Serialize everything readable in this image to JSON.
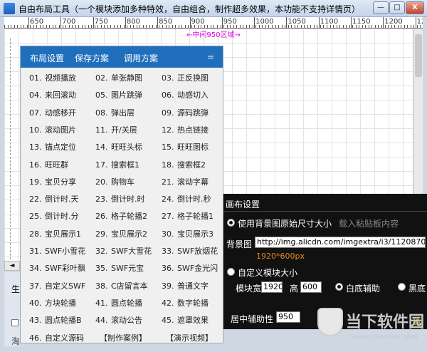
{
  "window": {
    "title": "自由布局工具（一个模块添加多种特效，自由组合，制作超多效果，本功能不支持详情页）",
    "min": "—",
    "max": "□",
    "close": "X"
  },
  "ruler": {
    "labels": [
      "650",
      "700",
      "750",
      "800",
      "850",
      "900",
      "950",
      "1000",
      "1050",
      "1100",
      "1150",
      "1200",
      "1250"
    ]
  },
  "canvas": {
    "center_label": "←中间950区域→"
  },
  "scroll": {
    "left_arrow": "◄"
  },
  "bottom_left": {
    "text1": "生",
    "text2": "淘"
  },
  "panel": {
    "tabs": [
      "布局设置",
      "保存方案",
      "调用方案",
      "="
    ],
    "items": [
      [
        "01.",
        "视频播放"
      ],
      [
        "02.",
        "单张静图"
      ],
      [
        "03.",
        "正反换图"
      ],
      [
        "04.",
        "来回滚动"
      ],
      [
        "05.",
        "图片跳弹"
      ],
      [
        "06.",
        "动感切入"
      ],
      [
        "07.",
        "动感移开"
      ],
      [
        "08.",
        "弹出层"
      ],
      [
        "09.",
        "源码跳弹"
      ],
      [
        "10.",
        "滚动图片"
      ],
      [
        "11.",
        "开/关层"
      ],
      [
        "12.",
        "热点链接"
      ],
      [
        "13.",
        "锚点定位"
      ],
      [
        "14.",
        "旺旺头标"
      ],
      [
        "15.",
        "旺旺图标"
      ],
      [
        "16.",
        "旺旺群"
      ],
      [
        "17.",
        "搜索框1"
      ],
      [
        "18.",
        "搜索框2"
      ],
      [
        "19.",
        "宝贝分享"
      ],
      [
        "20.",
        "购物车"
      ],
      [
        "21.",
        "滚动字幕"
      ],
      [
        "22.",
        "倒计时.天"
      ],
      [
        "23.",
        "倒计时.时"
      ],
      [
        "24.",
        "倒计时.秒"
      ],
      [
        "25.",
        "倒计时.分"
      ],
      [
        "26.",
        "格子轮播2"
      ],
      [
        "27.",
        "格子轮播1"
      ],
      [
        "28.",
        "宝贝展示1"
      ],
      [
        "29.",
        "宝贝展示2"
      ],
      [
        "30.",
        "宝贝展示3"
      ],
      [
        "31.",
        "SWF小雪花"
      ],
      [
        "32.",
        "SWF大雪花"
      ],
      [
        "33.",
        "SWF放烟花"
      ],
      [
        "34.",
        "SWF彩叶飘"
      ],
      [
        "35.",
        "SWF元宝"
      ],
      [
        "36.",
        "SWF金光闪"
      ],
      [
        "37.",
        "自定义SWF"
      ],
      [
        "38.",
        "C店留言本"
      ],
      [
        "39.",
        "普通文字"
      ],
      [
        "40.",
        "方块轮播"
      ],
      [
        "41.",
        "圆点轮播"
      ],
      [
        "42.",
        "数字轮播"
      ],
      [
        "43.",
        "圆点轮播B"
      ],
      [
        "44.",
        "滚动公告"
      ],
      [
        "45.",
        "遮罩效果"
      ],
      [
        "46.",
        "自定义源码"
      ],
      [
        "",
        "【制作案例】"
      ],
      [
        "",
        "【演示视频】"
      ]
    ]
  },
  "settings": {
    "title": "画布设置",
    "use_bg_size": "使用背景图原始尺寸大小",
    "load_paste": "载入粘贴板内容",
    "bg_label": "背景图",
    "bg_url": "http://img.alicdn.com/imgextra/i3/1120870168/TB27YtL",
    "bg_size_hint": "1920*600px",
    "custom_size": "自定义模块大小",
    "width_label": "模块宽",
    "width_value": "1920",
    "height_label": "高",
    "height_value": "600",
    "white_aux": "白底辅助",
    "black_aux": "黑底",
    "center_aux_label": "居中辅助性",
    "center_aux_value": "950",
    "side_text": "确"
  },
  "watermark": {
    "title": "当下软件园",
    "url": "www.downxia.com"
  }
}
